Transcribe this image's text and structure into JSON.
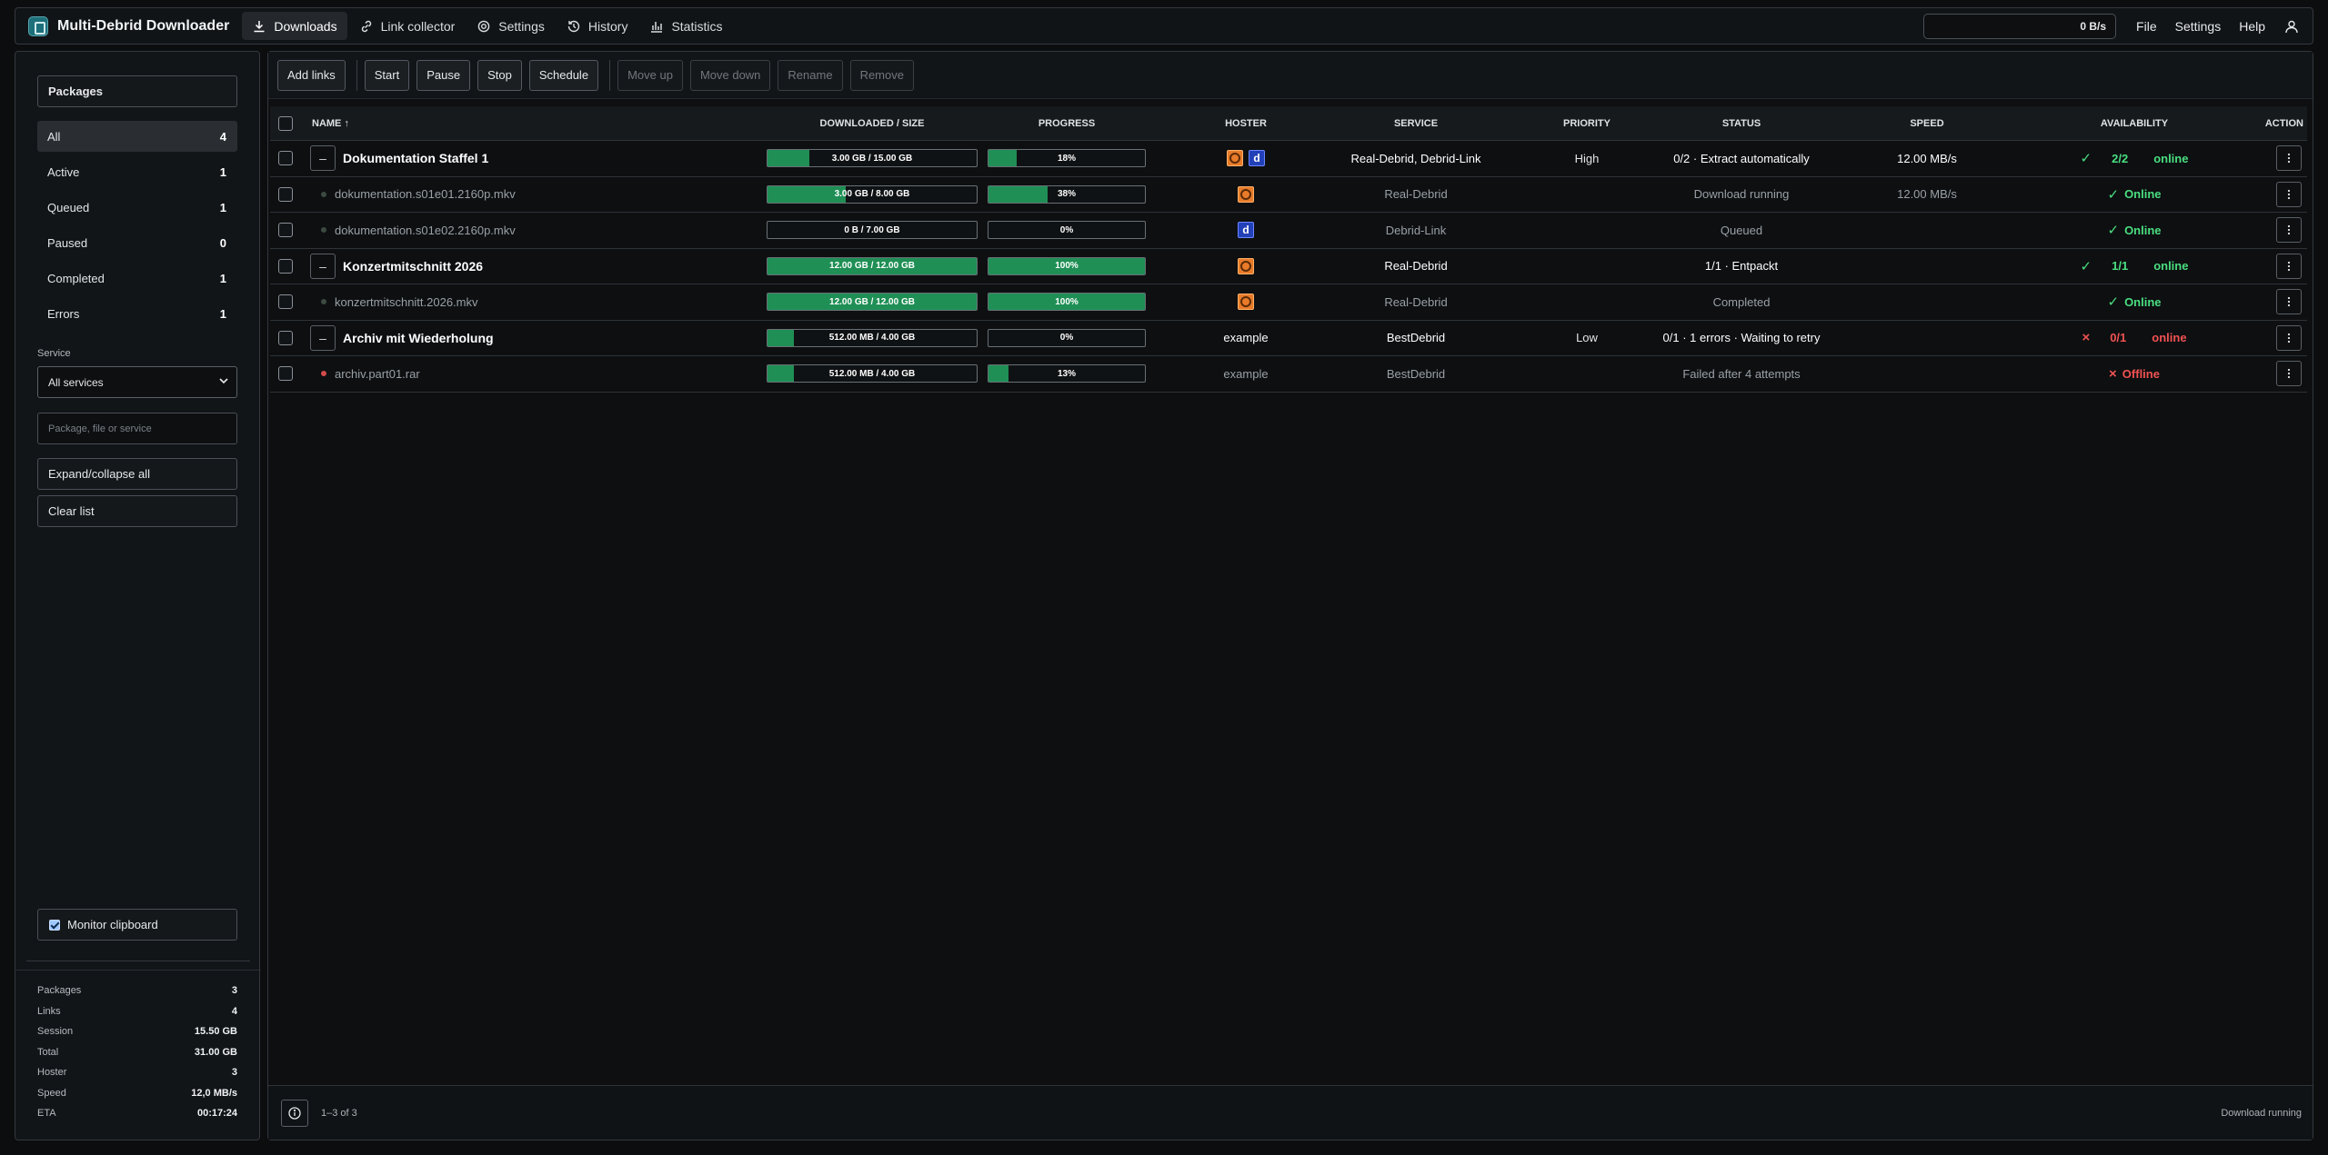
{
  "app": {
    "title": "Multi-Debrid Downloader"
  },
  "nav": {
    "tabs": [
      {
        "label": "Downloads",
        "icon": "download-icon",
        "active": true
      },
      {
        "label": "Link collector",
        "icon": "link-icon",
        "active": false
      },
      {
        "label": "Settings",
        "icon": "gear-icon",
        "active": false
      },
      {
        "label": "History",
        "icon": "history-icon",
        "active": false
      },
      {
        "label": "Statistics",
        "icon": "bar-chart-icon",
        "active": false
      }
    ],
    "speed": "0 B/s",
    "menu": [
      "File",
      "Settings",
      "Help"
    ]
  },
  "sidebar": {
    "packages_label": "Packages",
    "filters": [
      {
        "label": "All",
        "count": "4",
        "active": true
      },
      {
        "label": "Active",
        "count": "1",
        "active": false
      },
      {
        "label": "Queued",
        "count": "1",
        "active": false
      },
      {
        "label": "Paused",
        "count": "0",
        "active": false
      },
      {
        "label": "Completed",
        "count": "1",
        "active": false
      },
      {
        "label": "Errors",
        "count": "1",
        "active": false
      }
    ],
    "service_label": "Service",
    "service_selected": "All services",
    "search_placeholder": "Package, file or service",
    "expand_label": "Expand/collapse all",
    "clear_label": "Clear list",
    "monitor_label": "Monitor clipboard",
    "monitor_checked": true,
    "stats": [
      {
        "label": "Packages",
        "value": "3"
      },
      {
        "label": "Links",
        "value": "4"
      },
      {
        "label": "Session",
        "value": "15.50 GB"
      },
      {
        "label": "Total",
        "value": "31.00 GB"
      },
      {
        "label": "Hoster",
        "value": "3"
      },
      {
        "label": "Speed",
        "value": "12,0 MB/s"
      },
      {
        "label": "ETA",
        "value": "00:17:24"
      }
    ]
  },
  "toolbar": {
    "add_links": "Add links",
    "start": "Start",
    "pause": "Pause",
    "stop": "Stop",
    "schedule": "Schedule",
    "move_up": "Move up",
    "move_down": "Move down",
    "rename": "Rename",
    "remove": "Remove"
  },
  "table": {
    "headers": {
      "name": "NAME ↑",
      "size": "DOWNLOADED / SIZE",
      "progress": "PROGRESS",
      "hoster": "HOSTER",
      "service": "SERVICE",
      "priority": "PRIORITY",
      "status": "STATUS",
      "speed": "SPEED",
      "availability": "AVAILABILITY",
      "action": "ACTION"
    },
    "rows": [
      {
        "type": "package",
        "name": "Dokumentation Staffel 1",
        "size": "3.00 GB / 15.00 GB",
        "size_fraction": 0.2,
        "progress": "18%",
        "progress_fraction": 0.18,
        "hosters": [
          "real-debrid-icon",
          "debrid-link-icon"
        ],
        "service": "Real-Debrid, Debrid-Link",
        "priority": "High",
        "status": "0/2 · Extract automatically",
        "speed": "12.00 MB/s",
        "avail_mark": "✓",
        "avail_count": "2/2",
        "avail_text": "online",
        "avail_ok": true
      },
      {
        "type": "file",
        "name": "dokumentation.s01e01.2160p.mkv",
        "size": "3.00 GB / 8.00 GB",
        "size_fraction": 0.375,
        "progress": "38%",
        "progress_fraction": 0.38,
        "hosters": [
          "real-debrid-icon"
        ],
        "service": "Real-Debrid",
        "priority": "",
        "status": "Download running",
        "speed": "12.00 MB/s",
        "avail_mark": "✓",
        "avail_text": "Online",
        "avail_ok": true
      },
      {
        "type": "file",
        "name": "dokumentation.s01e02.2160p.mkv",
        "size": "0 B / 7.00 GB",
        "size_fraction": 0,
        "progress": "0%",
        "progress_fraction": 0,
        "hosters": [
          "debrid-link-icon"
        ],
        "service": "Debrid-Link",
        "priority": "",
        "status": "Queued",
        "speed": "",
        "avail_mark": "✓",
        "avail_text": "Online",
        "avail_ok": true
      },
      {
        "type": "package",
        "name": "Konzertmitschnitt 2026",
        "size": "12.00 GB / 12.00 GB",
        "size_fraction": 1,
        "progress": "100%",
        "progress_fraction": 1,
        "hosters": [
          "real-debrid-icon"
        ],
        "service": "Real-Debrid",
        "priority": "",
        "status": "1/1 · Entpackt",
        "speed": "",
        "avail_mark": "✓",
        "avail_count": "1/1",
        "avail_text": "online",
        "avail_ok": true
      },
      {
        "type": "file",
        "name": "konzertmitschnitt.2026.mkv",
        "size": "12.00 GB / 12.00 GB",
        "size_fraction": 1,
        "progress": "100%",
        "progress_fraction": 1,
        "hosters": [
          "real-debrid-icon"
        ],
        "service": "Real-Debrid",
        "priority": "",
        "status": "Completed",
        "speed": "",
        "avail_mark": "✓",
        "avail_text": "Online",
        "avail_ok": true
      },
      {
        "type": "package",
        "name": "Archiv mit Wiederholung",
        "size": "512.00 MB / 4.00 GB",
        "size_fraction": 0.125,
        "progress": "0%",
        "progress_fraction": 0,
        "hoster_text": "example",
        "service": "BestDebrid",
        "priority": "Low",
        "status": "0/1 · 1 errors · Waiting to retry",
        "speed": "",
        "avail_mark": "×",
        "avail_count": "0/1",
        "avail_text": "online",
        "avail_ok": false,
        "avail_text_ok": false
      },
      {
        "type": "file",
        "name": "archiv.part01.rar",
        "size": "512.00 MB / 4.00 GB",
        "size_fraction": 0.125,
        "progress": "13%",
        "progress_fraction": 0.13,
        "hoster_text": "example",
        "service": "BestDebrid",
        "priority": "",
        "status": "Failed after 4 attempts",
        "speed": "",
        "avail_mark": "×",
        "avail_text": "Offline",
        "avail_ok": false,
        "error": true
      }
    ]
  },
  "footer": {
    "range": "1–3 of 3",
    "status": "Download running"
  },
  "colors": {
    "accent_green": "#1f8f55",
    "ok": "#4ade80",
    "error": "#f05252"
  }
}
